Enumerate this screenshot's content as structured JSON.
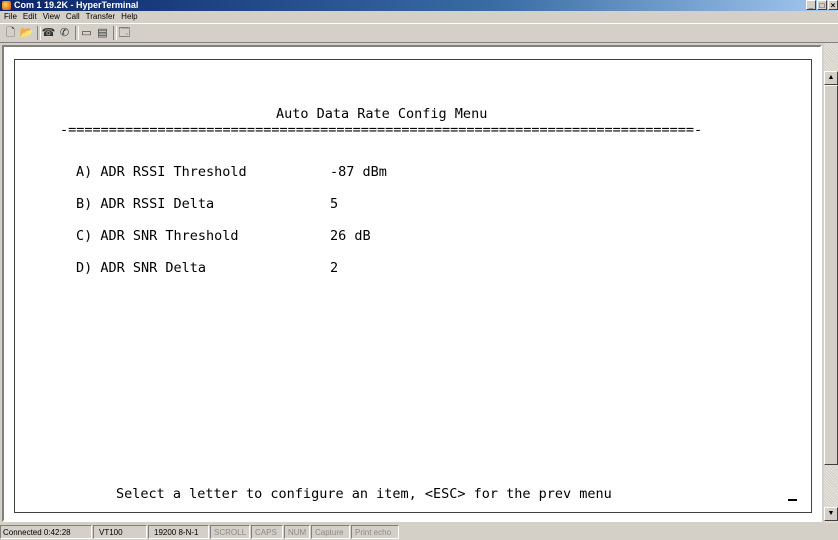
{
  "window": {
    "title": "Com 1 19.2K - HyperTerminal"
  },
  "menubar": {
    "items": [
      "File",
      "Edit",
      "View",
      "Call",
      "Transfer",
      "Help"
    ]
  },
  "toolbar": {
    "icons": [
      "new-icon",
      "open-icon",
      "connect-icon",
      "disconnect-icon",
      "send-icon",
      "receive-icon",
      "properties-icon"
    ]
  },
  "terminal": {
    "menu_title": "Auto Data Rate Config Menu",
    "divider": "-=============================================================================-",
    "options": [
      {
        "label": "A) ADR RSSI Threshold",
        "value": "-87 dBm"
      },
      {
        "label": "B) ADR RSSI Delta",
        "value": "5"
      },
      {
        "label": "C) ADR SNR Threshold",
        "value": "26 dB"
      },
      {
        "label": "D) ADR SNR Delta",
        "value": "2"
      }
    ],
    "prompt": "Select a letter to configure an item, <ESC> for the prev menu"
  },
  "statusbar": {
    "connected": "Connected 0:42:28",
    "emulation": "VT100",
    "port_settings": "19200 8-N-1",
    "scroll": "SCROLL",
    "caps": "CAPS",
    "num": "NUM",
    "capture": "Capture",
    "print_echo": "Print echo"
  }
}
